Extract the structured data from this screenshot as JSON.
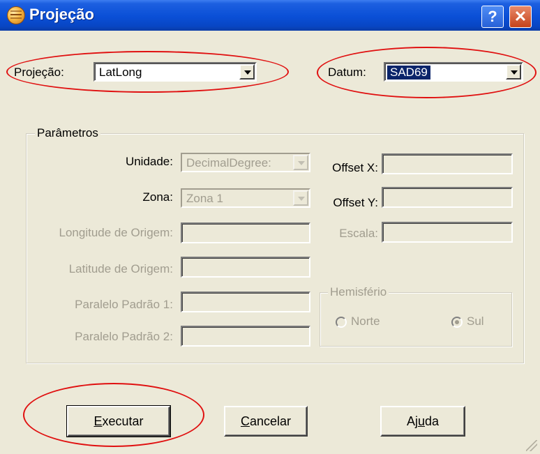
{
  "window": {
    "title": "Projeção",
    "help_glyph": "?",
    "close_glyph": "✕"
  },
  "top": {
    "projecao_label": "Projeção:",
    "projecao_value": "LatLong",
    "datum_label": "Datum:",
    "datum_value": "SAD69"
  },
  "params": {
    "group_title": "Parâmetros",
    "unidade_label": "Unidade:",
    "unidade_value": "DecimalDegree:",
    "zona_label": "Zona:",
    "zona_value": "Zona 1",
    "longitude_label": "Longitude de Origem:",
    "latitude_label": "Latitude de Origem:",
    "paralelo1_label": "Paralelo Padrão 1:",
    "paralelo2_label": "Paralelo Padrão 2:",
    "offset_x_label": "Offset X:",
    "offset_y_label": "Offset Y:",
    "escala_label": "Escala:",
    "hemisferio": {
      "title": "Hemisfério",
      "norte_label": "Norte",
      "sul_label": "Sul",
      "selected": "Sul"
    }
  },
  "buttons": {
    "executar_u": "E",
    "executar_rest": "xecutar",
    "cancelar_u": "C",
    "cancelar_rest": "ancelar",
    "ajuda_pre": "Aj",
    "ajuda_u": "u",
    "ajuda_post": "da"
  },
  "colors": {
    "annotation": "#e01010",
    "title_bar": "#0a4fd6",
    "selection": "#0a246a"
  }
}
